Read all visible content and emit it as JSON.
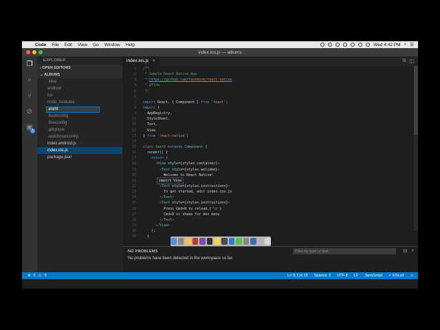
{
  "menubar": {
    "app": "Code",
    "items": [
      "File",
      "Edit",
      "View",
      "Go",
      "Window",
      "Help"
    ],
    "clock": "Wed 4:42 PM"
  },
  "window": {
    "title": "index.ios.js — albums"
  },
  "activity": {
    "badge": "1"
  },
  "explorer": {
    "header": "EXPLORER",
    "open_editors": "OPEN EDITORS",
    "project": "ALBUMS",
    "items": [
      ".idea",
      "android",
      "ios",
      "node_modules"
    ],
    "rename_value": ".eslint",
    "items_after": [
      ".buckconfig",
      ".flowconfig",
      ".gitignore",
      ".watchmanconfig",
      "index.android.js"
    ],
    "selected": "index.ios.js",
    "last": "package.json"
  },
  "editor": {
    "tab_label": "index.ios.js",
    "suggestion": "import View"
  },
  "code_lines": [
    {
      "n": "1",
      "parts": [
        {
          "c": "c-com",
          "t": "/**"
        }
      ]
    },
    {
      "n": "2",
      "parts": [
        {
          "c": "c-com",
          "t": " * Sample React Native App"
        }
      ]
    },
    {
      "n": "3",
      "parts": [
        {
          "c": "c-com",
          "t": " * "
        },
        {
          "c": "c-link",
          "t": "https://github.com/facebook/react-native"
        }
      ]
    },
    {
      "n": "4",
      "parts": [
        {
          "c": "c-com",
          "t": " * @flow"
        }
      ]
    },
    {
      "n": "5",
      "parts": [
        {
          "c": "c-com",
          "t": " */"
        }
      ]
    },
    {
      "n": "6",
      "parts": []
    },
    {
      "n": "7",
      "parts": [
        {
          "c": "c-kw",
          "t": "import"
        },
        {
          "c": "c-norm",
          "t": " React, { Component } "
        },
        {
          "c": "c-kw",
          "t": "from"
        },
        {
          "c": "c-str",
          "t": " 'react'"
        },
        {
          "c": "c-norm",
          "t": ";"
        }
      ]
    },
    {
      "n": "8",
      "parts": [
        {
          "c": "c-kw",
          "t": "import"
        },
        {
          "c": "c-norm",
          "t": " {"
        }
      ]
    },
    {
      "n": "9",
      "parts": [
        {
          "c": "c-norm",
          "t": "  AppRegistry,"
        }
      ]
    },
    {
      "n": "10",
      "parts": [
        {
          "c": "c-norm",
          "t": "  StyleSheet,"
        }
      ]
    },
    {
      "n": "11",
      "parts": [
        {
          "c": "c-norm",
          "t": "  Text,"
        }
      ]
    },
    {
      "n": "12",
      "parts": [
        {
          "c": "c-norm",
          "t": "  View"
        }
      ]
    },
    {
      "n": "13",
      "parts": [
        {
          "c": "c-norm",
          "t": "} "
        },
        {
          "c": "c-kw",
          "t": "from"
        },
        {
          "c": "c-str",
          "t": " 'react-native'"
        },
        {
          "c": "c-norm",
          "t": ";"
        }
      ]
    },
    {
      "n": "14",
      "parts": []
    },
    {
      "n": "15",
      "parts": [
        {
          "c": "c-kw",
          "t": "class"
        },
        {
          "c": "c-tag",
          "t": " test1"
        },
        {
          "c": "c-kw",
          "t": " extends"
        },
        {
          "c": "c-tag",
          "t": " Component"
        },
        {
          "c": "c-norm",
          "t": " {"
        }
      ]
    },
    {
      "n": "16",
      "parts": [
        {
          "c": "c-norm",
          "t": "  render() {"
        }
      ]
    },
    {
      "n": "17",
      "parts": [
        {
          "c": "c-kw",
          "t": "    return"
        },
        {
          "c": "c-norm",
          "t": " ("
        }
      ]
    },
    {
      "n": "18",
      "parts": [
        {
          "c": "c-gray",
          "t": "      <"
        },
        {
          "c": "c-tag",
          "t": "View"
        },
        {
          "c": "c-attr",
          "t": " style"
        },
        {
          "c": "c-norm",
          "t": "={styles.container}"
        },
        {
          "c": "c-gray",
          "t": ">"
        }
      ]
    },
    {
      "n": "19",
      "parts": [
        {
          "c": "c-gray",
          "t": "        <"
        },
        {
          "c": "c-tag",
          "t": "Text"
        },
        {
          "c": "c-attr",
          "t": " style"
        },
        {
          "c": "c-norm",
          "t": "={styles.welcome}"
        },
        {
          "c": "c-gray",
          "t": ">"
        }
      ]
    },
    {
      "n": "20",
      "parts": [
        {
          "c": "c-txt",
          "t": "          Welcome to React Native!"
        }
      ]
    },
    {
      "n": "21",
      "parts": [
        {
          "c": "c-gray",
          "t": "        </"
        },
        {
          "c": "c-tag",
          "t": "Text"
        },
        {
          "c": "c-gray",
          "t": ">"
        }
      ]
    },
    {
      "n": "22",
      "parts": [
        {
          "c": "c-gray",
          "t": "        <"
        },
        {
          "c": "c-tag",
          "t": "Text"
        },
        {
          "c": "c-attr",
          "t": " style"
        },
        {
          "c": "c-norm",
          "t": "={styles.instructions}"
        },
        {
          "c": "c-gray",
          "t": ">"
        }
      ]
    },
    {
      "n": "23",
      "parts": [
        {
          "c": "c-txt",
          "t": "          To get started, edit index.ios.js"
        }
      ]
    },
    {
      "n": "24",
      "parts": [
        {
          "c": "c-gray",
          "t": "        </"
        },
        {
          "c": "c-tag",
          "t": "Text"
        },
        {
          "c": "c-gray",
          "t": ">"
        }
      ]
    },
    {
      "n": "25",
      "parts": [
        {
          "c": "c-gray",
          "t": "        <"
        },
        {
          "c": "c-tag",
          "t": "Text"
        },
        {
          "c": "c-attr",
          "t": " style"
        },
        {
          "c": "c-norm",
          "t": "={styles.instructions}"
        },
        {
          "c": "c-gray",
          "t": ">"
        }
      ]
    },
    {
      "n": "26",
      "parts": [
        {
          "c": "c-txt",
          "t": "          Press Cmd+R to reload,{"
        },
        {
          "c": "c-str",
          "t": "'\\n'"
        },
        {
          "c": "c-txt",
          "t": "}"
        }
      ]
    },
    {
      "n": "27",
      "parts": [
        {
          "c": "c-txt",
          "t": "          Cmd+D or shake for dev menu"
        }
      ]
    },
    {
      "n": "28",
      "parts": [
        {
          "c": "c-gray",
          "t": "        </"
        },
        {
          "c": "c-tag",
          "t": "Text"
        },
        {
          "c": "c-gray",
          "t": ">"
        }
      ]
    },
    {
      "n": "29",
      "parts": [
        {
          "c": "c-gray",
          "t": "      </"
        },
        {
          "c": "c-tag",
          "t": "View"
        },
        {
          "c": "c-gray",
          "t": ">"
        }
      ]
    },
    {
      "n": "30",
      "parts": [
        {
          "c": "c-norm",
          "t": "    );"
        }
      ]
    },
    {
      "n": "31",
      "parts": [
        {
          "c": "c-norm",
          "t": "  }"
        }
      ]
    }
  ],
  "panel": {
    "title": "NO PROBLEMS",
    "filter_placeholder": "Filter by type or text",
    "message": "No problems have been detected in the workspace so far."
  },
  "status": {
    "errors": "0",
    "warnings": "0",
    "position": "Ln 9, Col 15",
    "spaces": "Spaces: 2",
    "encoding": "UTF-8",
    "eol": "LF",
    "language": "JavaScript",
    "linter": "ESLint"
  },
  "colors": {
    "accent": "#007acc",
    "selection": "#094771"
  }
}
